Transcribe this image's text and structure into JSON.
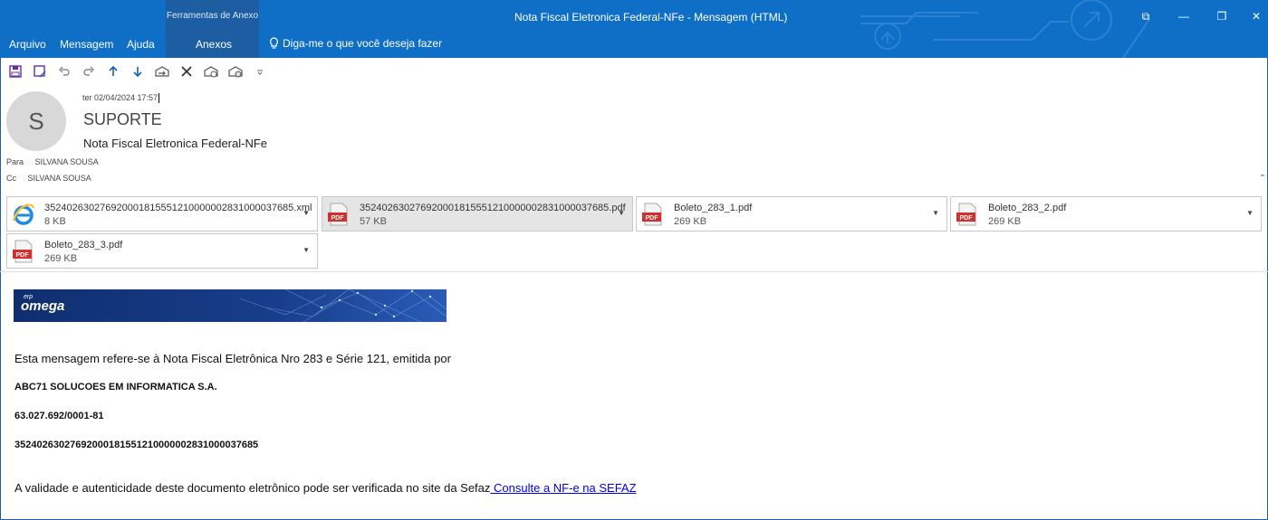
{
  "window": {
    "title": "Nota Fiscal Eletronica Federal-NFe  -  Mensagem (HTML)",
    "context_group": "Ferramentas de Anexo",
    "controls": {
      "restore": "⧉",
      "minimize": "—",
      "maximize": "❐",
      "close": "✕"
    }
  },
  "ribbon": {
    "tabs": [
      "Arquivo",
      "Mensagem",
      "Ajuda",
      "Anexos"
    ],
    "tell_me": "Diga-me o que você deseja fazer"
  },
  "colors": {
    "accent": "#0f6fc6",
    "context_tab": "#1d5ea3",
    "link": "#0000ee",
    "pdf_red": "#d32f2f"
  },
  "header": {
    "avatar_initial": "S",
    "date": "ter 02/04/2024 17:57",
    "sender": "SUPORTE",
    "subject": "Nota Fiscal Eletronica Federal-NFe",
    "to_label": "Para",
    "to_value": "SILVANA SOUSA",
    "cc_label": "Cc",
    "cc_value": "SILVANA SOUSA"
  },
  "attachments": [
    {
      "name": "35240263027692000181555121000000283100003768​5.xml",
      "size": "8 KB",
      "icon": "ie-xml-icon"
    },
    {
      "name": "35240263027692000181555121000000283100003768​5.pdf",
      "size": "57 KB",
      "icon": "pdf-icon"
    },
    {
      "name": "Boleto_283_1.pdf",
      "size": "269 KB",
      "icon": "pdf-icon"
    },
    {
      "name": "Boleto_283_2.pdf",
      "size": "269 KB",
      "icon": "pdf-icon"
    },
    {
      "name": "Boleto_283_3.pdf",
      "size": "269 KB",
      "icon": "pdf-icon"
    }
  ],
  "pdf_icon_label": "PDF",
  "banner": {
    "erp": "erp",
    "brand": "omega"
  },
  "body": {
    "intro": "Esta mensagem refere-se à Nota Fiscal Eletrônica Nro 283 e Série 121, emitida por",
    "company": "ABC71 SOLUCOES EM INFORMATICA S.A.",
    "cnpj": "63.027.692/0001-81",
    "key": "35240263027692000181551210000002831000037685",
    "validity": "A validade e autenticidade deste documento eletrônico pode ser verificada no site da Sefaz",
    "link_text": " Consulte a NF-e na SEFAZ"
  }
}
